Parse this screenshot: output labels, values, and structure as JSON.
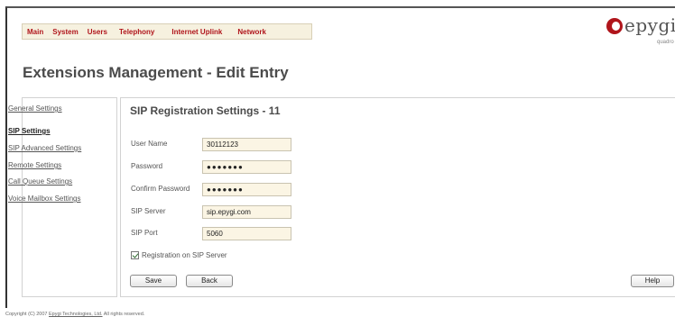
{
  "nav": {
    "items": [
      "Main",
      "System",
      "Users",
      "Telephony",
      "Internet Uplink",
      "Network"
    ]
  },
  "logo": {
    "name": "epygi",
    "tagline": "quadro"
  },
  "page": {
    "title": "Extensions Management - Edit Entry"
  },
  "sidebar": {
    "items": [
      "General Settings",
      "SIP Settings",
      "SIP Advanced Settings",
      "Remote Settings",
      "Call Queue Settings",
      "Voice Mailbox Settings"
    ],
    "active": "SIP Settings"
  },
  "form": {
    "title": "SIP Registration Settings - 11",
    "fields": [
      {
        "label": "User Name",
        "value": "30112123",
        "type": "text"
      },
      {
        "label": "Password",
        "value": "●●●●●●●",
        "type": "password"
      },
      {
        "label": "Confirm Password",
        "value": "●●●●●●●",
        "type": "password"
      },
      {
        "label": "SIP Server",
        "value": "sip.epygi.com",
        "type": "text"
      },
      {
        "label": "SIP Port",
        "value": "5060",
        "type": "text"
      }
    ],
    "checkbox": {
      "label": "Registration on SIP Server",
      "checked": true
    }
  },
  "buttons": {
    "save": "Save",
    "back": "Back",
    "help": "Help"
  },
  "footer": {
    "prefix": "Copyright (C) 2007 ",
    "link": "Epygi Technologies, Ltd.",
    "suffix": " All rights reserved."
  },
  "colors": {
    "nav_text": "#b0151b",
    "nav_bg": "#f6f1df",
    "input_bg": "#fbf5e4"
  }
}
